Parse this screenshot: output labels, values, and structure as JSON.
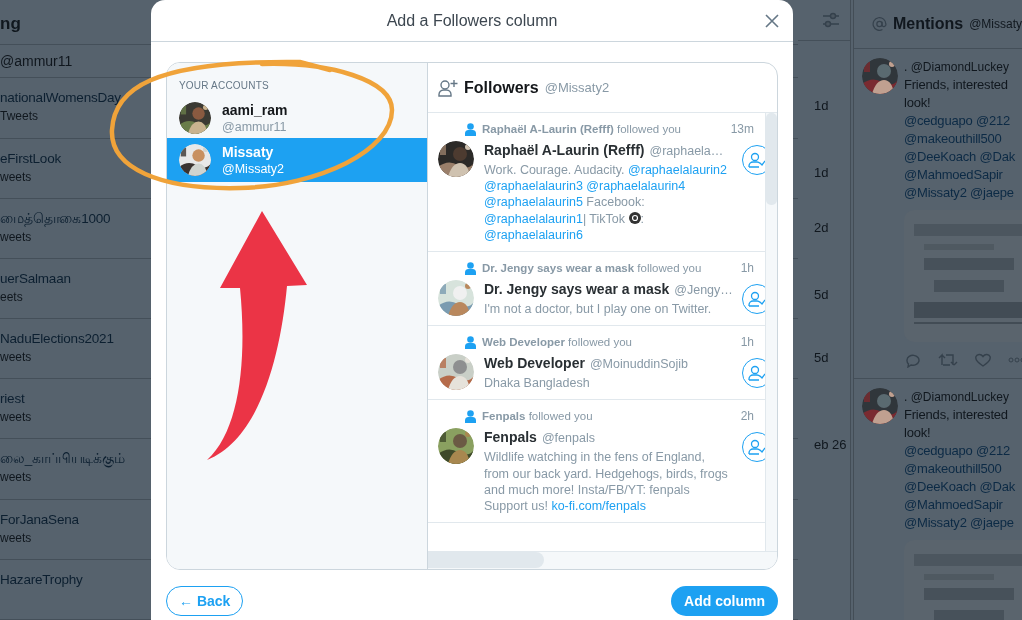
{
  "trends_column": {
    "heading": "ng",
    "subheading": "@ammur11",
    "items": [
      {
        "title": "nationalWomensDay",
        "subtitle": "Tweets"
      },
      {
        "title": "eFirstLook",
        "subtitle": "weets"
      },
      {
        "title": "மைத்தொகை1000",
        "subtitle": "weets"
      },
      {
        "title": "uerSalmaan",
        "subtitle": "eets"
      },
      {
        "title": "NaduElections2021",
        "subtitle": "weets"
      },
      {
        "title": "riest",
        "subtitle": "weets"
      },
      {
        "title": "லை_காப்பியடிக்கும்",
        "subtitle": "weets"
      },
      {
        "title": "ForJanaSena",
        "subtitle": "weets"
      },
      {
        "title": "HazareTrophy"
      }
    ]
  },
  "times_column": {
    "times": [
      "1d",
      "1d",
      "2d",
      "5d",
      "5d",
      "eb 26"
    ]
  },
  "mentions_column": {
    "title": "Mentions",
    "account": "@Missaty",
    "tweets": [
      {
        "name": ".",
        "handle": "@DiamondLuckey",
        "text_lines": [
          "Friends, interested",
          "look!"
        ],
        "link_lines": [
          "@cedguapo @212",
          "@makeouthill500",
          "@DeeKoach @Dak",
          "@MahmoedSapir",
          "@Missaty2 @jaepe"
        ],
        "actions_visible": true
      },
      {
        "name": ".",
        "handle": "@DiamondLuckey",
        "text_lines": [
          "Friends, interested",
          "look!"
        ],
        "link_lines": [
          "@cedguapo @212",
          "@makeouthill500",
          "@DeeKoach @Dak",
          "@MahmoedSapir",
          "@Missaty2 @jaepe"
        ],
        "actions_visible": false
      }
    ]
  },
  "dialog": {
    "title": "Add a Followers column",
    "accounts_heading": "YOUR ACCOUNTS",
    "accounts": [
      {
        "name": "aami_ram",
        "handle": "@ammur11",
        "selected": false
      },
      {
        "name": "Missaty",
        "handle": "@Missaty2",
        "selected": true
      }
    ],
    "column_title": "Followers",
    "column_account": "@Missaty2",
    "followers": [
      {
        "followed_line": "**Raphaël A-Laurin (Refff)** followed you",
        "time": "13m",
        "name": "Raphaël A-Laurin (Refff)",
        "handle": "@raphaela…",
        "bio": [
          {
            "kind": "text",
            "text": "Work. Courage. Audacity. "
          },
          {
            "kind": "link",
            "text": "@raphaelalaurin2"
          },
          {
            "kind": "link",
            "text": "@raphaelalaurin3"
          },
          {
            "kind": "link",
            "text": "@raphaelalaurin4"
          },
          {
            "kind": "link",
            "text": "@raphaelalaurin5"
          },
          {
            "kind": "text",
            "text": " Facebook: "
          },
          {
            "kind": "link",
            "text": "@raphaelalaurin1"
          },
          {
            "kind": "text",
            "text": "| TikTok "
          },
          {
            "kind": "icon"
          },
          {
            "kind": "text",
            "text": ": "
          },
          {
            "kind": "link",
            "text": "@raphaelalaurin6"
          }
        ]
      },
      {
        "followed_line": "**Dr. Jengy says wear a mask** followed you",
        "time": "1h",
        "name": "Dr. Jengy says wear a mask",
        "handle": "@Jengy…",
        "bio": [
          {
            "kind": "text",
            "text": "I'm not a doctor, but I play one on Twitter."
          }
        ]
      },
      {
        "followed_line": "**Web Developer** followed you",
        "time": "1h",
        "name": "Web Developer",
        "handle": "@MoinuddinSojib",
        "bio": [
          {
            "kind": "text",
            "text": "Dhaka Bangladesh"
          }
        ]
      },
      {
        "followed_line": "**Fenpals** followed you",
        "time": "2h",
        "name": "Fenpals",
        "handle": "@fenpals",
        "bio": [
          {
            "kind": "text",
            "text": "Wildlife watching in the fens of England, from our back yard. Hedgehogs, birds, frogs and much more! Insta/FB/YT: fenpals Support us! "
          },
          {
            "kind": "link",
            "text": "ko-fi.com/fenpals"
          }
        ]
      }
    ],
    "back_button": "← Back",
    "add_button": "Add column"
  }
}
